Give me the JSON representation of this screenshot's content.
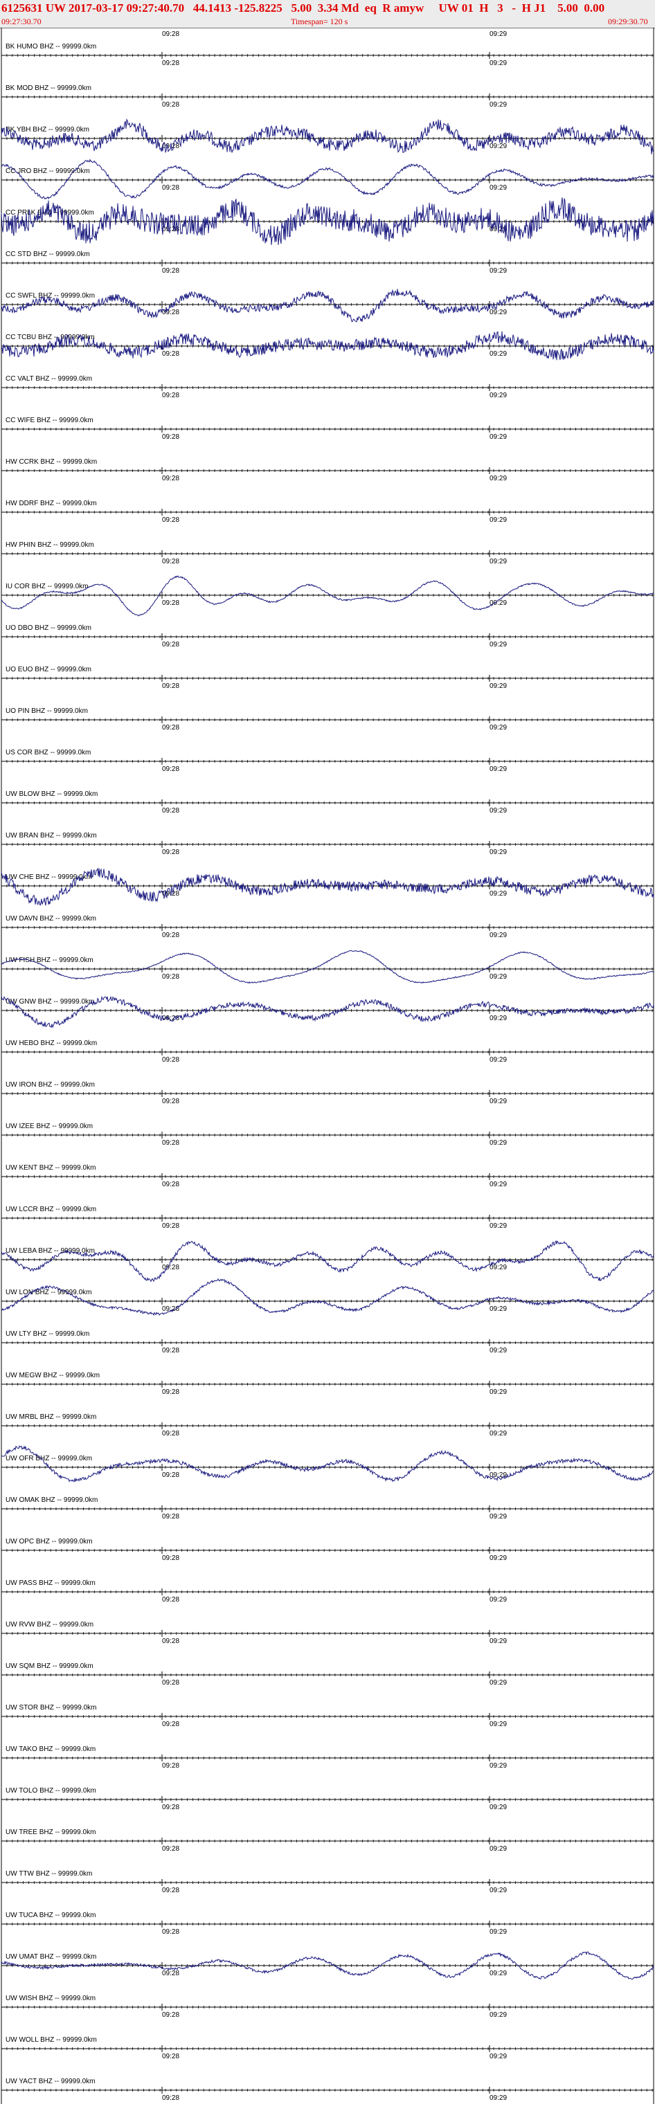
{
  "header": {
    "title": "6125631 UW 2017-03-17 09:27:40.70   44.1413 -125.8225   5.00  3.34 Md  eq  R amyw     UW 01  H   3   -  H J1    5.00  0.00",
    "start_time": "09:27:30.70",
    "timespan": "Timespan= 120 s",
    "end_time": "09:29:30.70"
  },
  "colors": {
    "title": "#e00000",
    "trace": "#1a1a80",
    "axis": "#000000",
    "header_bg": "#ececec"
  },
  "chart_data": {
    "type": "line",
    "time_labels": [
      "09:28",
      "09:29"
    ],
    "channels": [
      {
        "label": "BK HUMO BHZ -- 99999.0km",
        "amp": 0
      },
      {
        "label": "BK MOD BHZ -- 99999.0km",
        "amp": 0
      },
      {
        "label": "BK YBH BHZ -- 99999.0km",
        "amp": 18,
        "noise": 0.6
      },
      {
        "label": "CC JRO BHZ -- 99999.0km",
        "amp": 24,
        "noise": 0.1
      },
      {
        "label": "CC PRLK BHZ -- 99999.0km",
        "amp": 20,
        "noise": 1.0
      },
      {
        "label": "CC STD BHZ -- 99999.0km",
        "amp": 0
      },
      {
        "label": "CC SWFL BHZ -- 99999.0km",
        "amp": 22,
        "noise": 0.3
      },
      {
        "label": "CC TCBU BHZ -- 99999.0km",
        "amp": 18,
        "noise": 0.6
      },
      {
        "label": "CC VALT BHZ -- 99999.0km",
        "amp": 0
      },
      {
        "label": "CC WIFE BHZ -- 99999.0km",
        "amp": 0
      },
      {
        "label": "HW CCRK BHZ -- 99999.0km",
        "amp": 0
      },
      {
        "label": "HW DDRF BHZ -- 99999.0km",
        "amp": 0
      },
      {
        "label": "HW PHIN BHZ -- 99999.0km",
        "amp": 0
      },
      {
        "label": "IU COR BHZ -- 99999.0km",
        "amp": 26,
        "noise": 0.05
      },
      {
        "label": "UO DBO BHZ -- 99999.0km",
        "amp": 0
      },
      {
        "label": "UO EUO BHZ -- 99999.0km",
        "amp": 0
      },
      {
        "label": "UO PIN BHZ -- 99999.0km",
        "amp": 0
      },
      {
        "label": "US COR BHZ -- 99999.0km",
        "amp": 0
      },
      {
        "label": "UW BLOW BHZ -- 99999.0km",
        "amp": 0
      },
      {
        "label": "UW BRAN BHZ -- 99999.0km",
        "amp": 0
      },
      {
        "label": "UW CHE BHZ -- 99999.0km",
        "amp": 18,
        "noise": 0.5
      },
      {
        "label": "UW DAVN BHZ -- 99999.0km",
        "amp": 0
      },
      {
        "label": "UW FISH BHZ -- 99999.0km",
        "amp": 22,
        "noise": 0.05
      },
      {
        "label": "UW GNW BHZ -- 99999.0km",
        "amp": 24,
        "noise": 0.2
      },
      {
        "label": "UW HEBO BHZ -- 99999.0km",
        "amp": 0
      },
      {
        "label": "UW IRON BHZ -- 99999.0km",
        "amp": 0
      },
      {
        "label": "UW IZEE BHZ -- 99999.0km",
        "amp": 0
      },
      {
        "label": "UW KENT BHZ -- 99999.0km",
        "amp": 0
      },
      {
        "label": "UW LCCR BHZ -- 99999.0km",
        "amp": 0
      },
      {
        "label": "UW LEBA BHZ -- 99999.0km",
        "amp": 22,
        "noise": 0.15
      },
      {
        "label": "UW LON BHZ -- 99999.0km",
        "amp": 24,
        "noise": 0.1
      },
      {
        "label": "UW LTY BHZ -- 99999.0km",
        "amp": 0
      },
      {
        "label": "UW MEGW BHZ -- 99999.0km",
        "amp": 0
      },
      {
        "label": "UW MRBL BHZ -- 99999.0km",
        "amp": 0
      },
      {
        "label": "UW OFR BHZ -- 99999.0km",
        "amp": 22,
        "noise": 0.15
      },
      {
        "label": "UW OMAK BHZ -- 99999.0km",
        "amp": 0
      },
      {
        "label": "UW OPC BHZ -- 99999.0km",
        "amp": 0
      },
      {
        "label": "UW PASS BHZ -- 99999.0km",
        "amp": 0
      },
      {
        "label": "UW RVW BHZ -- 99999.0km",
        "amp": 0
      },
      {
        "label": "UW SQM BHZ -- 99999.0km",
        "amp": 0
      },
      {
        "label": "UW STOR BHZ -- 99999.0km",
        "amp": 0
      },
      {
        "label": "UW TAKO BHZ -- 99999.0km",
        "amp": 0
      },
      {
        "label": "UW TOLO BHZ -- 99999.0km",
        "amp": 0
      },
      {
        "label": "UW TREE BHZ -- 99999.0km",
        "amp": 0
      },
      {
        "label": "UW TTW BHZ -- 99999.0km",
        "amp": 0
      },
      {
        "label": "UW TUCA BHZ -- 99999.0km",
        "amp": 0
      },
      {
        "label": "UW UMAT BHZ -- 99999.0km",
        "amp": 24,
        "noise": 0.1
      },
      {
        "label": "UW WISH BHZ -- 99999.0km",
        "amp": 0
      },
      {
        "label": "UW WOLL BHZ -- 99999.0km",
        "amp": 0
      },
      {
        "label": "UW YACT BHZ -- 99999.0km",
        "amp": 0
      }
    ]
  }
}
